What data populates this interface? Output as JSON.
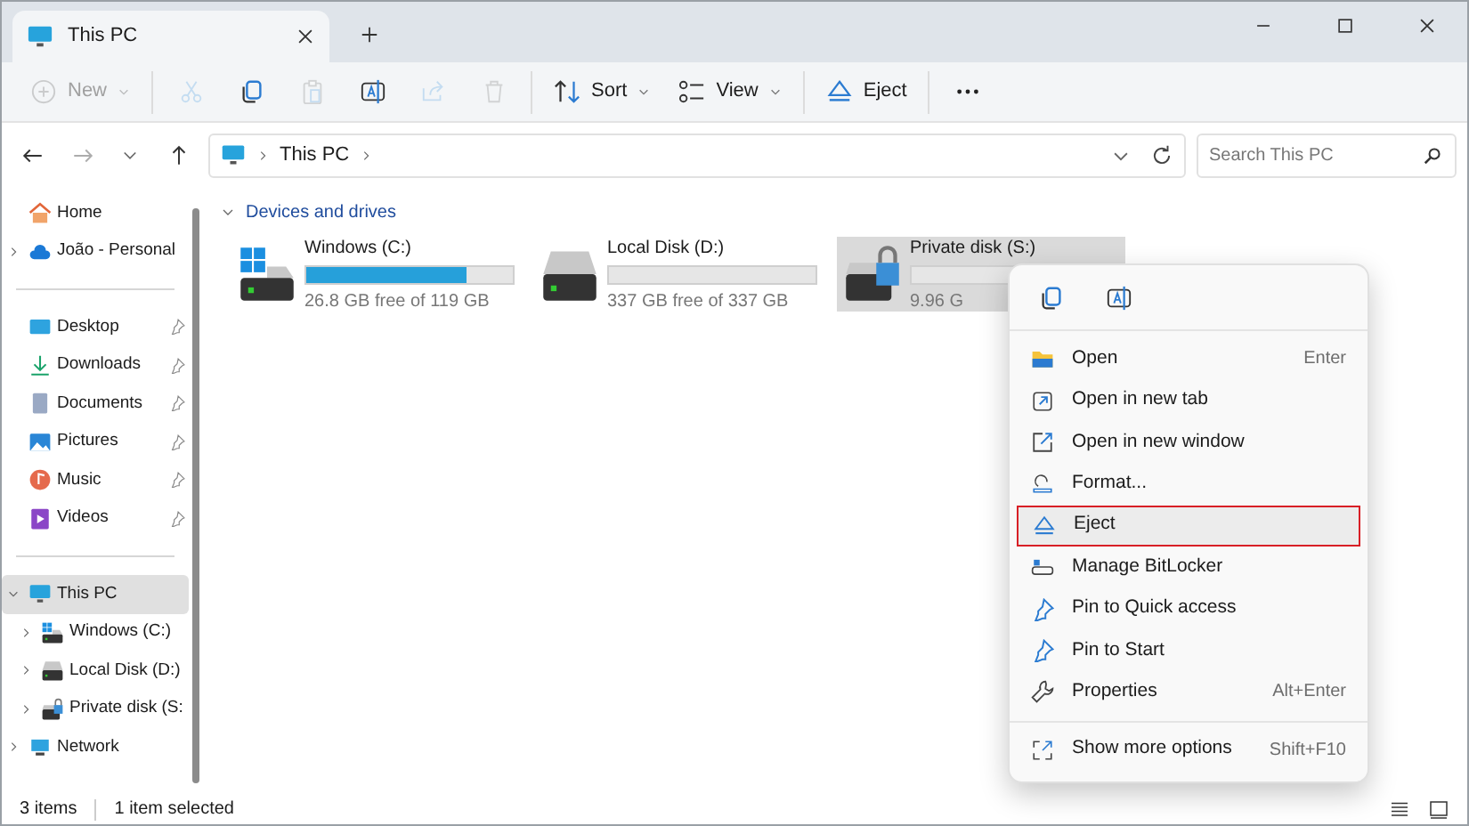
{
  "window": {
    "tab_title": "This PC"
  },
  "toolbar": [
    {
      "kind": "new",
      "label": "New",
      "disabled": true,
      "dropdown": true
    },
    {
      "kind": "cut",
      "disabled": true
    },
    {
      "kind": "copy",
      "disabled": false
    },
    {
      "kind": "paste",
      "disabled": true
    },
    {
      "kind": "rename",
      "disabled": false
    },
    {
      "kind": "share",
      "disabled": true
    },
    {
      "kind": "delete",
      "disabled": true
    },
    {
      "kind": "sort",
      "label": "Sort",
      "disabled": false,
      "dropdown": true
    },
    {
      "kind": "view",
      "label": "View",
      "disabled": false,
      "dropdown": true
    },
    {
      "kind": "eject",
      "label": "Eject",
      "disabled": false,
      "dropdown": false
    },
    {
      "kind": "more",
      "disabled": false
    }
  ],
  "navigation": {
    "back_disabled": false,
    "forward_disabled": true
  },
  "breadcrumb": [
    "This PC"
  ],
  "search": {
    "placeholder": "Search This PC"
  },
  "sidebar": {
    "groups": [
      [
        {
          "kind": "home",
          "label": "Home",
          "expandable": false,
          "pinned": false,
          "selected": false
        },
        {
          "kind": "cloud",
          "label": "João - Personal",
          "expandable": true,
          "pinned": false,
          "selected": false
        }
      ],
      [
        {
          "kind": "desktop",
          "label": "Desktop",
          "expandable": false,
          "pinned": true,
          "selected": false
        },
        {
          "kind": "downloads",
          "label": "Downloads",
          "expandable": false,
          "pinned": true,
          "selected": false
        },
        {
          "kind": "documents",
          "label": "Documents",
          "expandable": false,
          "pinned": true,
          "selected": false
        },
        {
          "kind": "pictures",
          "label": "Pictures",
          "expandable": false,
          "pinned": true,
          "selected": false
        },
        {
          "kind": "music",
          "label": "Music",
          "expandable": false,
          "pinned": true,
          "selected": false
        },
        {
          "kind": "videos",
          "label": "Videos",
          "expandable": false,
          "pinned": true,
          "selected": false
        }
      ],
      [
        {
          "kind": "pc",
          "label": "This PC",
          "expandable": true,
          "expanded": true,
          "pinned": false,
          "selected": true,
          "children": [
            {
              "kind": "windrive",
              "label": "Windows (C:)",
              "expandable": true,
              "pinned": false,
              "selected": false
            },
            {
              "kind": "drive",
              "label": "Local Disk (D:)",
              "expandable": true,
              "pinned": false,
              "selected": false
            },
            {
              "kind": "lockdrive",
              "label": "Private disk (S:",
              "expandable": true,
              "pinned": false,
              "selected": false
            }
          ]
        },
        {
          "kind": "network",
          "label": "Network",
          "expandable": true,
          "pinned": false,
          "selected": false
        }
      ]
    ]
  },
  "section": {
    "title": "Devices and drives",
    "expanded": true
  },
  "drives": [
    {
      "kind": "windrive",
      "name": "Windows (C:)",
      "level": 0.775,
      "free": "26.8 GB free of 119 GB",
      "selected": false
    },
    {
      "kind": "drive",
      "name": "Local Disk (D:)",
      "level": 0,
      "free": "337 GB free of 337 GB",
      "selected": false
    },
    {
      "kind": "lockdrive",
      "name": "Private disk (S:)",
      "level": 0,
      "free": "9.96 G",
      "selected": true
    }
  ],
  "context_menu": {
    "quick_actions": [
      {
        "kind": "copy"
      },
      {
        "kind": "rename"
      }
    ],
    "sections": [
      [
        {
          "kind": "open",
          "label": "Open",
          "shortcut": "Enter",
          "highlighted": false
        },
        {
          "kind": "newtab",
          "label": "Open in new tab",
          "highlighted": false
        },
        {
          "kind": "newwindow",
          "label": "Open in new window",
          "highlighted": false
        },
        {
          "kind": "format",
          "label": "Format...",
          "highlighted": false
        },
        {
          "kind": "eject",
          "label": "Eject",
          "highlighted": true
        },
        {
          "kind": "bitlocker",
          "label": "Manage BitLocker",
          "highlighted": false
        },
        {
          "kind": "pin",
          "label": "Pin to Quick access",
          "highlighted": false
        },
        {
          "kind": "pin",
          "label": "Pin to Start",
          "highlighted": false
        },
        {
          "kind": "properties",
          "label": "Properties",
          "shortcut": "Alt+Enter",
          "highlighted": false
        }
      ],
      [
        {
          "kind": "more",
          "label": "Show more options",
          "shortcut": "Shift+F10",
          "highlighted": false
        }
      ]
    ]
  },
  "status_bar": {
    "items": "3 items",
    "selected": "1 item selected"
  }
}
